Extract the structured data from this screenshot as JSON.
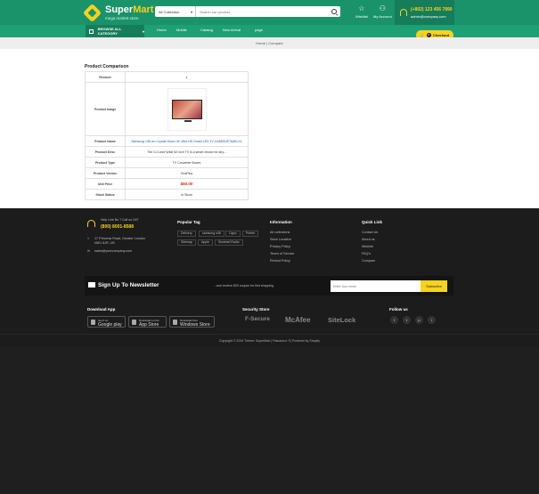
{
  "header": {
    "logo_name_part1": "Super",
    "logo_name_part2": "Mart",
    "logo_tagline": "mega market store",
    "search_category": "All Collection",
    "search_placeholder": "Search our product",
    "wishlist_label": "Wishlist",
    "account_label": "My Account",
    "phone": "(+802) 123 456 7890",
    "email": "admin@company.com"
  },
  "nav": {
    "browse_label": "BROWSE ALL CATEGORY",
    "items": [
      "Home",
      "Mobile",
      "Catalog",
      "New Arrival",
      "page"
    ],
    "checkout_label": "Checkout",
    "checkout_count": "0"
  },
  "breadcrumb": {
    "home": "Home",
    "current": "Compare"
  },
  "compare": {
    "title": "Product Comparison",
    "rows": [
      {
        "label": "Remove",
        "value": "x"
      },
      {
        "label": "Product Image",
        "value": ""
      },
      {
        "label": "Product Name",
        "value": "Samsung 138 cm Crystal Vision 4K Ultra HD Smart LED TV UA55DUE76AKLXL"
      },
      {
        "label": "Product Desc",
        "value": "The G-Curve Wide 52 Inch TV is a smart choice for any..."
      },
      {
        "label": "Product Type",
        "value": "TV Converter Boxes"
      },
      {
        "label": "Product Vendor",
        "value": "OnePlus"
      },
      {
        "label": "Unit Price",
        "value": "$50.00"
      },
      {
        "label": "Stock Status",
        "value": "In Stock"
      }
    ]
  },
  "footer": {
    "helpline_label": "Help Line No ? Call us 24/7",
    "helpline_number": "(800) 8001-8588",
    "address": "17 Princess Road, Greater London NW1 8JR, UK",
    "email": "sales@yourcompany.com",
    "popular_tag_title": "Popular Tag",
    "tags": [
      "Delivery",
      "samsung s08",
      "Oppo",
      "Printer",
      "Sitemap",
      "Apple",
      "Smartart Radio"
    ],
    "information_title": "Information",
    "information_links": [
      "All collections",
      "Store Location",
      "Privacy Policy",
      "Terms of Service",
      "Refund Policy"
    ],
    "quick_link_title": "Quick Link",
    "quick_links": [
      "Contact Us",
      "About us",
      "Wishlist",
      "FAQ's",
      "Compare"
    ],
    "newsletter_title": "Sign Up To Newsletter",
    "newsletter_sub": "...and receive $20 coupon for first shopping",
    "newsletter_placeholder": "Enter Your email",
    "subscribe_label": "Subscribe",
    "download_title": "Download App",
    "stores": [
      {
        "small": "Get it on",
        "name": "Google play"
      },
      {
        "small": "Download on the",
        "name": "App Store"
      },
      {
        "small": "Download from",
        "name": "Windows Store"
      }
    ],
    "security_title": "Security Store",
    "security_brands": [
      "F-Secure",
      "McAfee",
      "SiteLock"
    ],
    "follow_title": "Follow us",
    "social_icons": [
      "f",
      "t",
      "p",
      "i"
    ],
    "copyright": "Copyright © 2024 Theme: SuperMart | Password: ©| Powered by Shopify"
  }
}
